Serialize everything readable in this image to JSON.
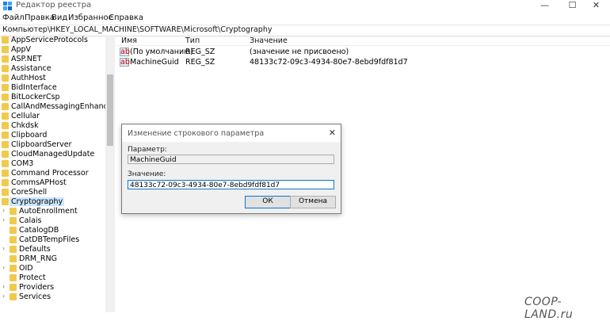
{
  "window": {
    "title": "Редактор реестра"
  },
  "menu": [
    "Файл",
    "Правка",
    "Вид",
    "Избранное",
    "Справка"
  ],
  "address_bar": "Компьютер\\HKEY_LOCAL_MACHINE\\SOFTWARE\\Microsoft\\Cryptography",
  "tree": {
    "items": [
      {
        "label": "AppServiceProtocols"
      },
      {
        "label": "AppV"
      },
      {
        "label": "ASP.NET"
      },
      {
        "label": "Assistance"
      },
      {
        "label": "AuthHost"
      },
      {
        "label": "BidInterface"
      },
      {
        "label": "BitLockerCsp"
      },
      {
        "label": "CallAndMessagingEnhancement"
      },
      {
        "label": "Cellular"
      },
      {
        "label": "Chkdsk"
      },
      {
        "label": "Clipboard"
      },
      {
        "label": "ClipboardServer"
      },
      {
        "label": "CloudManagedUpdate"
      },
      {
        "label": "COM3"
      },
      {
        "label": "Command Processor"
      },
      {
        "label": "CommsAPHost"
      },
      {
        "label": "CoreShell"
      },
      {
        "label": "Cryptography"
      },
      {
        "label": "AutoEnrollment"
      },
      {
        "label": "Calais"
      },
      {
        "label": "CatalogDB"
      },
      {
        "label": "CatDBTempFiles"
      },
      {
        "label": "Defaults"
      },
      {
        "label": "DRM_RNG"
      },
      {
        "label": "OID"
      },
      {
        "label": "Protect"
      },
      {
        "label": "Providers"
      },
      {
        "label": "Services"
      }
    ]
  },
  "list": {
    "headers": {
      "name": "Имя",
      "type": "Тип",
      "value": "Значение"
    },
    "rows": [
      {
        "name": "(По умолчанию)",
        "type": "REG_SZ",
        "value": "(значение не присвоено)",
        "icon": "ab"
      },
      {
        "name": "MachineGuid",
        "type": "REG_SZ",
        "value": "48133c72-09c3-4934-80e7-8ebd9fdf81d7",
        "icon": "ab"
      }
    ]
  },
  "dialog": {
    "title": "Изменение строкового параметра",
    "param_label": "Параметр:",
    "param_value": "MachineGuid",
    "value_label": "Значение:",
    "value_value": "48133c72-09c3-4934-80e7-8ebd9fdf81d7",
    "ok_label": "ОК",
    "cancel_label": "Отмена"
  },
  "watermark": "COOP-LAND.ru"
}
